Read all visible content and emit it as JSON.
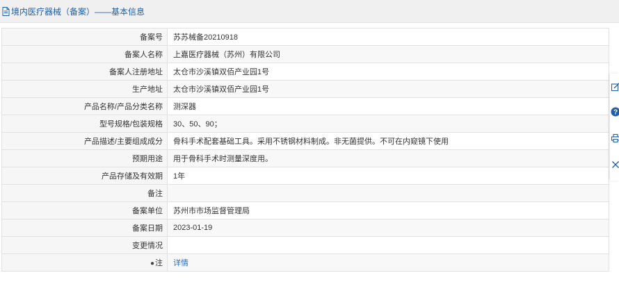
{
  "header": {
    "title": "境内医疗器械（备案）——基本信息",
    "icon": "document-icon"
  },
  "fields": [
    {
      "label": "备案号",
      "value": "苏苏械备20210918"
    },
    {
      "label": "备案人名称",
      "value": "上嘉医疗器械（苏州）有限公司"
    },
    {
      "label": "备案人注册地址",
      "value": "太仓市沙溪镇双佰产业园1号"
    },
    {
      "label": "生产地址",
      "value": "太仓市沙溪镇双佰产业园1号"
    },
    {
      "label": "产品名称/产品分类名称",
      "value": "测深器"
    },
    {
      "label": "型号规格/包装规格",
      "value": "30、50、90；"
    },
    {
      "label": "产品描述/主要组成成分",
      "value": "骨科手术配套基础工具。采用不锈钢材料制成。非无菌提供。不可在内窥镜下使用"
    },
    {
      "label": "预期用途",
      "value": "用于骨科手术时测量深度用。"
    },
    {
      "label": "产品存储及有效期",
      "value": "1年"
    },
    {
      "label": "备注",
      "value": ""
    },
    {
      "label": "备案单位",
      "value": "苏州市市场监督管理局"
    },
    {
      "label": "备案日期",
      "value": "2023-01-19"
    },
    {
      "label": "变更情况",
      "value": ""
    }
  ],
  "note_row": {
    "label": "注",
    "icon": "pin-icon",
    "link": "详情"
  },
  "side_toolbar": {
    "icons": [
      "edit-icon",
      "help-icon",
      "print-icon",
      "close-icon"
    ]
  },
  "colors": {
    "accent": "#1f5fa8",
    "link": "#1f6fc8",
    "help_icon": "#1f5fa8"
  }
}
